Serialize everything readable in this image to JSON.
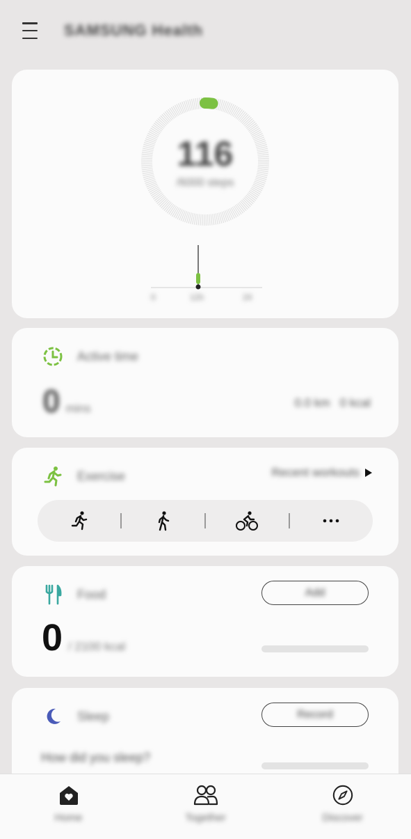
{
  "header": {
    "title": "SAMSUNG Health"
  },
  "steps": {
    "count": "116",
    "goal": "/6000 steps",
    "progress": 0.02,
    "chart_labels": [
      "0",
      "12h",
      "24"
    ],
    "colors": {
      "accent": "#7cc142",
      "track": "#e2e2e2"
    }
  },
  "active_time": {
    "title": "Active time",
    "value": "0",
    "unit": "mins",
    "distance": "0.0 km",
    "calories": "0 kcal",
    "colors": {
      "icon": "#7cc142"
    }
  },
  "exercise": {
    "title": "Exercise",
    "link_label": "Recent workouts",
    "items": [
      "run-icon",
      "walk-icon",
      "bike-icon",
      "more-icon"
    ],
    "colors": {
      "icon": "#7cc142"
    }
  },
  "food": {
    "title": "Food",
    "button_label": "Add",
    "value": "0",
    "unit": "/ 2100 kcal",
    "progress": 0,
    "colors": {
      "icon": "#3aa8a0"
    }
  },
  "sleep": {
    "title": "Sleep",
    "button_label": "Record",
    "question": "How did you sleep?",
    "colors": {
      "icon": "#4a5bb8"
    }
  },
  "nav": [
    {
      "label": "Home",
      "icon": "home-icon"
    },
    {
      "label": "Together",
      "icon": "people-icon"
    },
    {
      "label": "Discover",
      "icon": "compass-icon"
    }
  ]
}
